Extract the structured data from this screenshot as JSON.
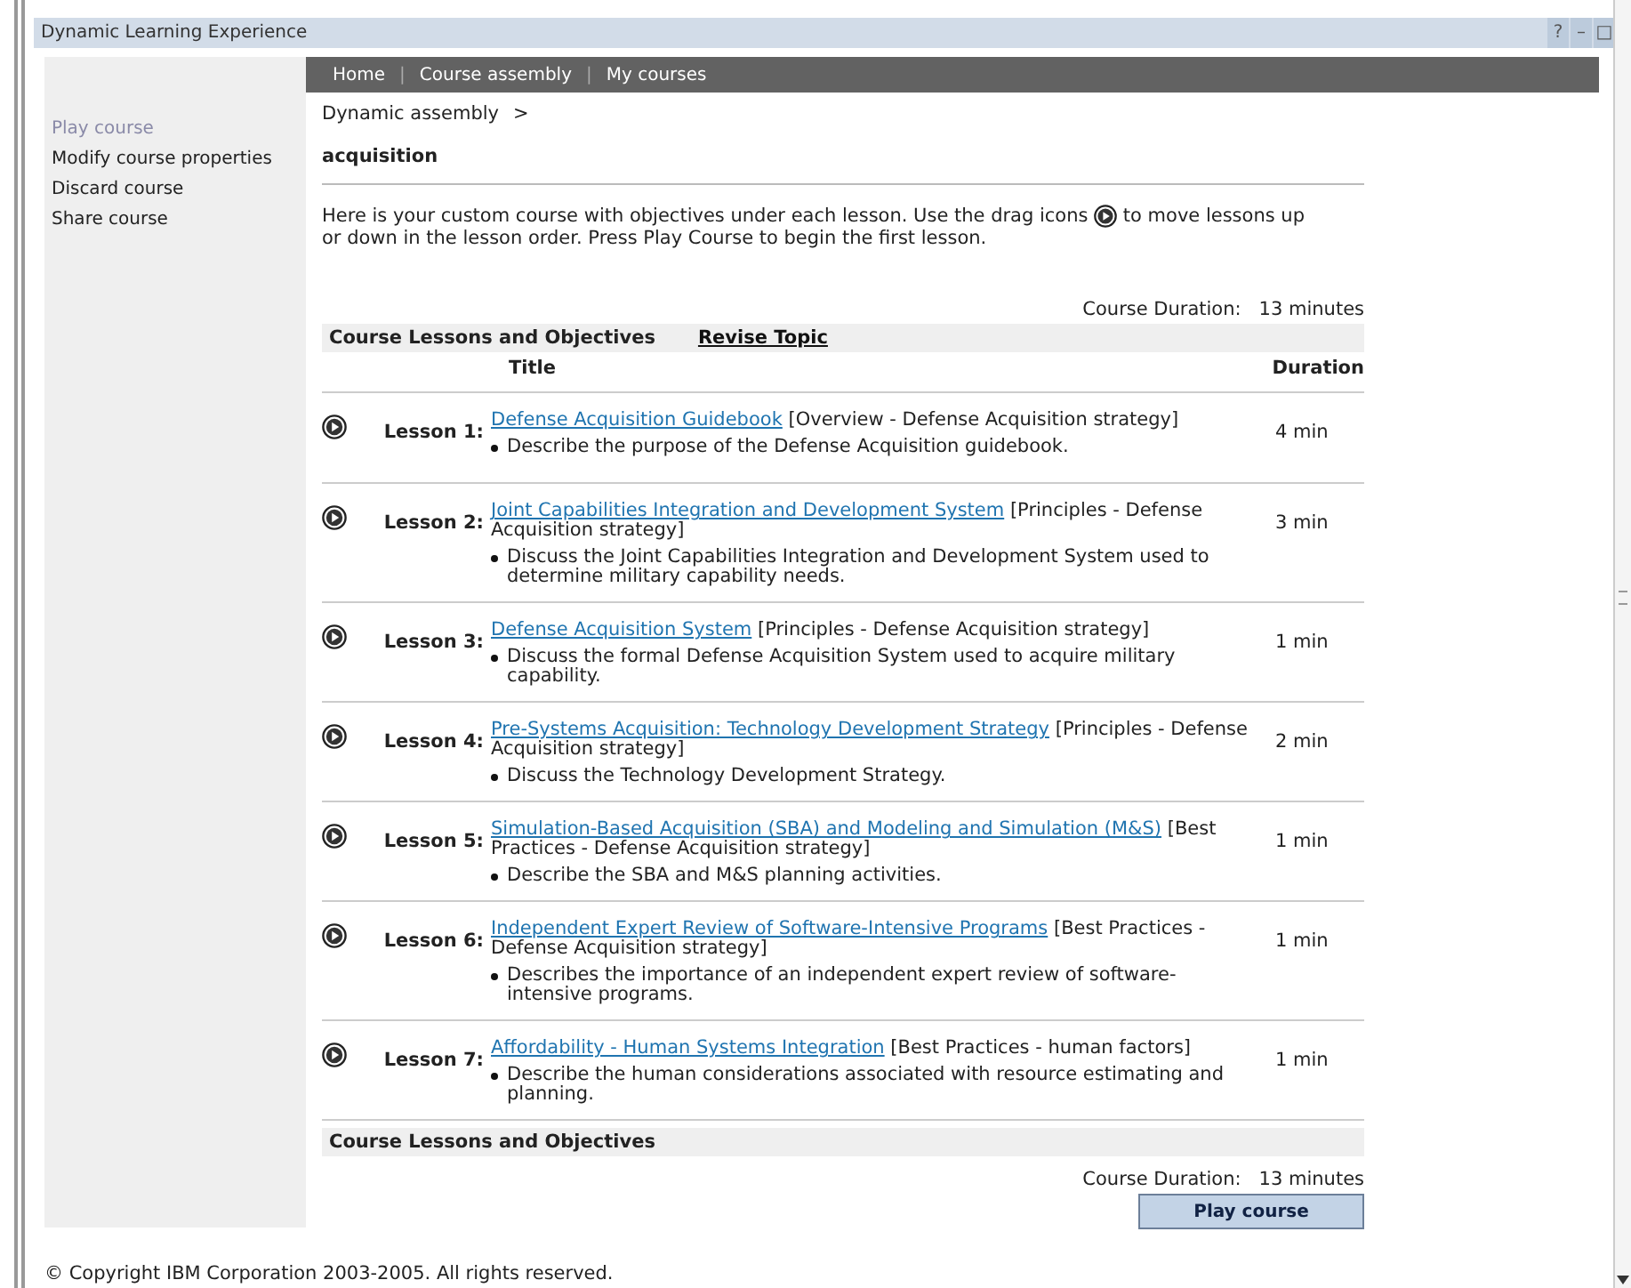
{
  "window": {
    "title": "Dynamic Learning Experience",
    "controls": [
      "?",
      "–",
      "□"
    ]
  },
  "nav": {
    "items": [
      "Home",
      "Course assembly",
      "My courses"
    ],
    "separator": "|"
  },
  "sidebar": {
    "items": [
      {
        "label": "Play course",
        "disabled": true
      },
      {
        "label": "Modify course properties",
        "disabled": false
      },
      {
        "label": "Discard course",
        "disabled": false
      },
      {
        "label": "Share course",
        "disabled": false
      }
    ]
  },
  "breadcrumb": {
    "items": [
      "Dynamic assembly"
    ],
    "separator": ">"
  },
  "course_name": "acquisition",
  "intro": {
    "before": "Here is your custom course with objectives under each lesson. Use the drag icons",
    "after": "to move lessons up",
    "second_line": "or down in the lesson order. Press Play Course to begin the first lesson."
  },
  "duration_top": {
    "label": "Course Duration:",
    "value": "13 minutes"
  },
  "table": {
    "section_title": "Course Lessons and Objectives",
    "revise_link": "Revise Topic",
    "columns": [
      "Title",
      "Duration"
    ],
    "rows": [
      {
        "label": "Lesson 1:",
        "link": "Defense Acquisition Guidebook",
        "category": "[Overview - Defense Acquisition strategy]",
        "objective": "Describe the purpose of the Defense Acquisition guidebook.",
        "duration": "4 min"
      },
      {
        "label": "Lesson 2:",
        "link": "Joint Capabilities Integration and Development System",
        "category": "[Principles - Defense Acquisition strategy]",
        "objective": "Discuss the Joint Capabilities Integration and Development System used to determine military capability needs.",
        "duration": "3 min"
      },
      {
        "label": "Lesson 3:",
        "link": "Defense Acquisition System",
        "category": "[Principles - Defense Acquisition strategy]",
        "objective": "Discuss the formal Defense Acquisition System used to acquire military capability.",
        "duration": "1 min"
      },
      {
        "label": "Lesson 4:",
        "link": "Pre-Systems Acquisition: Technology Development Strategy",
        "category": "[Principles - Defense Acquisition strategy]",
        "objective": "Discuss the Technology Development Strategy.",
        "duration": "2 min"
      },
      {
        "label": "Lesson 5:",
        "link": "Simulation-Based Acquisition (SBA) and Modeling and Simulation (M&S)",
        "category": "[Best Practices - Defense Acquisition strategy]",
        "objective": "Describe the SBA and M&S planning activities.",
        "duration": "1 min"
      },
      {
        "label": "Lesson 6:",
        "link": "Independent Expert Review of Software-Intensive Programs",
        "category": "[Best Practices - Defense Acquisition strategy]",
        "objective": "Describes the importance of an independent expert review of software-intensive programs.",
        "duration": "1 min"
      },
      {
        "label": "Lesson 7:",
        "link": "Affordability - Human Systems Integration",
        "category": "[Best Practices - human factors]",
        "objective": "Describe the human considerations associated with resource estimating and planning.",
        "duration": "1 min"
      }
    ],
    "footer_title": "Course Lessons and Objectives"
  },
  "duration_bottom": {
    "label": "Course Duration:",
    "value": "13 minutes"
  },
  "play_button": "Play course",
  "copyright": "© Copyright IBM Corporation 2003-2005. All rights reserved."
}
